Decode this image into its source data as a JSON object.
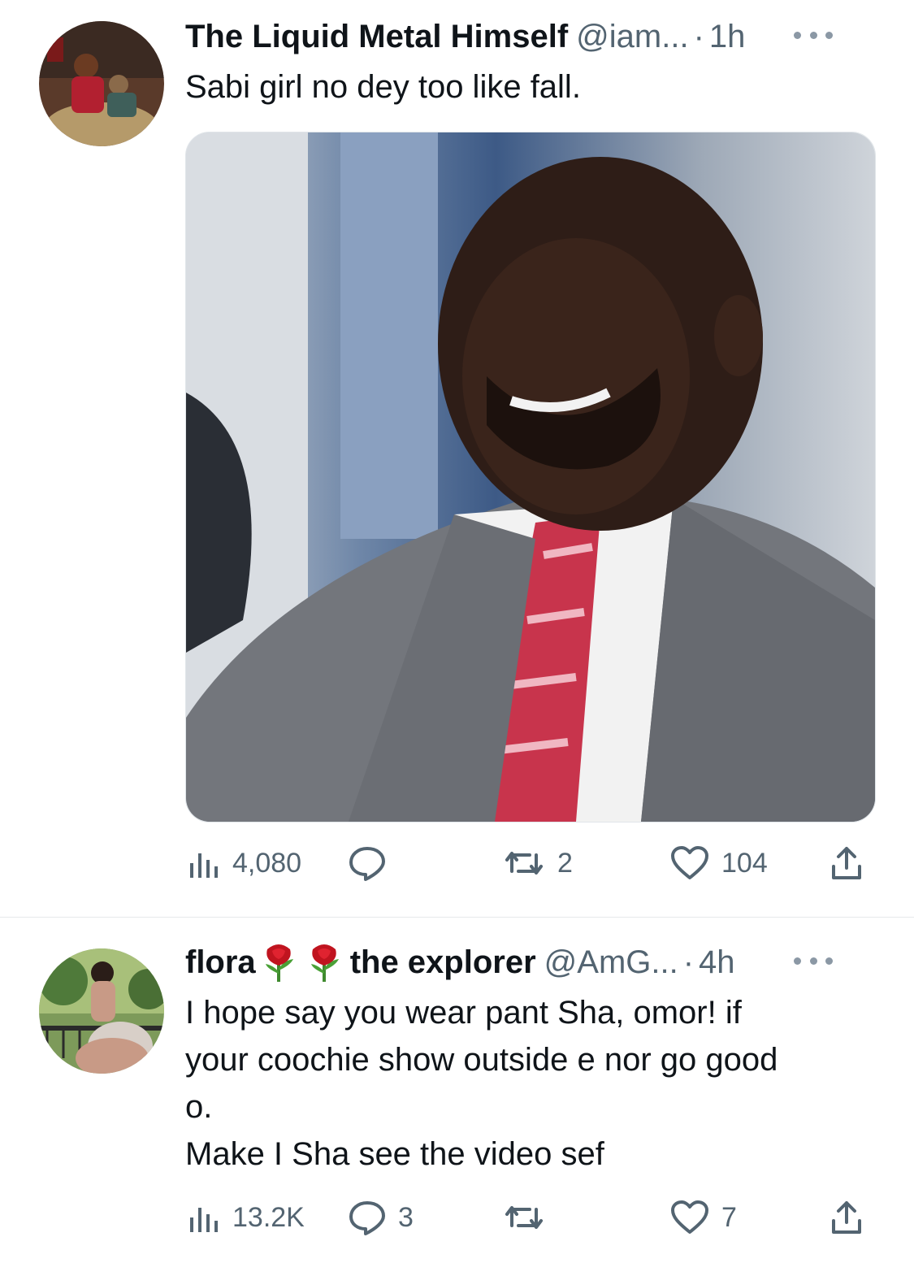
{
  "tweets": [
    {
      "name": "The Liquid Metal Himself",
      "handle": "@iam...",
      "dot": "·",
      "time": "1h",
      "text": "Sabi girl no dey too like fall.",
      "stats": {
        "views": "4,080",
        "replies": "",
        "retweets": "2",
        "likes": "104"
      }
    },
    {
      "name_part1": "flora",
      "name_part2": "the explorer",
      "emoji": [
        "rose-icon",
        "rose-icon"
      ],
      "handle": "@AmG...",
      "dot": "·",
      "time": "4h",
      "text_lines": [
        "I hope say you wear pant Sha, omor!  if",
        "your coochie show outside e nor go good",
        "o.",
        "Make I Sha see the video sef"
      ],
      "stats": {
        "views": "13.2K",
        "replies": "3",
        "retweets": "",
        "likes": "7"
      }
    }
  ],
  "colors": {
    "text": "#0f1419",
    "muted": "#536471",
    "divider": "#e6e9eb"
  }
}
